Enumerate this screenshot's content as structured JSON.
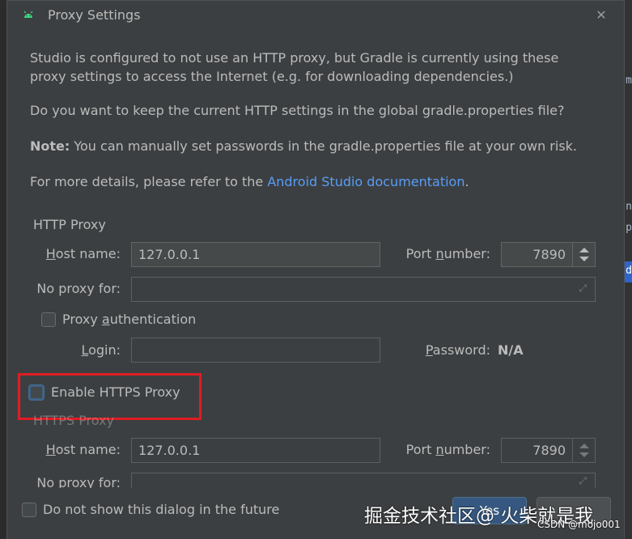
{
  "background": {
    "glyphs": [
      "m",
      "n",
      "p",
      "d"
    ]
  },
  "dialog": {
    "title": "Proxy Settings",
    "intro": "Studio is configured to not use an HTTP proxy, but Gradle is currently using these proxy settings to access the Internet (e.g. for downloading dependencies.)",
    "question": "Do you want to keep the current HTTP settings in the global gradle.properties file?",
    "note_bold": "Note:",
    "note_text": " You can manually set passwords in the gradle.properties file at your own risk.",
    "details_prefix": "For more details, please refer to the ",
    "details_link": "Android Studio documentation",
    "details_suffix": "."
  },
  "http_proxy": {
    "section_title": "HTTP Proxy",
    "host_label_u": "H",
    "host_label_rest": "ost name:",
    "host_value": "127.0.0.1",
    "port_label_pre": "Port ",
    "port_label_u": "n",
    "port_label_rest": "umber:",
    "port_value": "7890",
    "no_proxy_label": "No proxy for:",
    "no_proxy_value": "",
    "auth_label_pre": "Proxy ",
    "auth_label_u": "a",
    "auth_label_rest": "uthentication",
    "login_label_u": "L",
    "login_label_rest": "ogin:",
    "login_value": "",
    "password_label_u": "P",
    "password_label_rest": "assword:",
    "password_value": "N/A"
  },
  "https_proxy": {
    "enable_label": "Enable HTTPS Proxy",
    "section_title": "HTTPS Proxy",
    "host_label_u": "H",
    "host_label_rest": "ost name:",
    "host_value": "127.0.0.1",
    "port_label_pre": "Port ",
    "port_label_u": "n",
    "port_label_rest": "umber:",
    "port_value": "7890",
    "no_proxy_label": "No proxy for:"
  },
  "footer": {
    "dont_show_label": "Do not show this dialog in the future",
    "primary_button": "Yes"
  },
  "watermark": {
    "main": "掘金技术社区@ 火柴就是我",
    "sub": "CSDN @mojo001"
  },
  "colors": {
    "link": "#589df6",
    "highlight_box": "#e01c24",
    "dialog_bg": "#3c3f41"
  }
}
